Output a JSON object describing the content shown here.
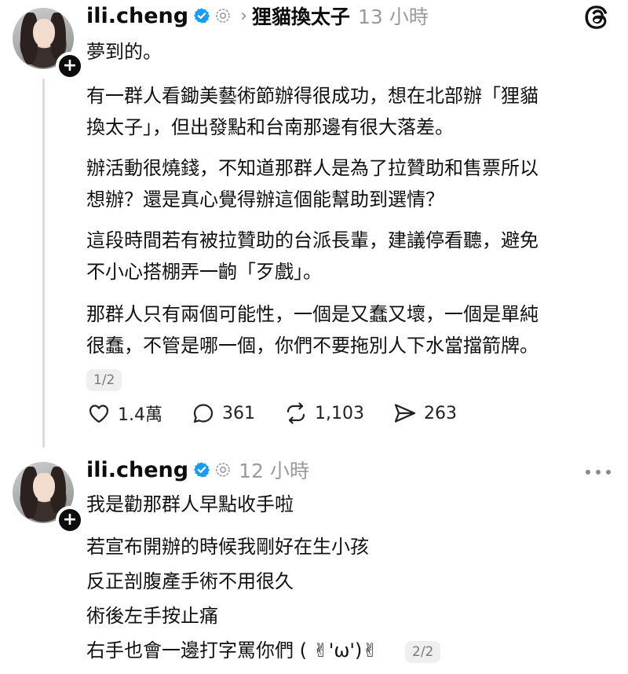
{
  "post1": {
    "username": "ili.cheng",
    "topic": "狸貓換太子",
    "time": "13 小時",
    "paragraphs": [
      [
        "夢到的。"
      ],
      [
        "有一群人看鋤美藝術節辦得很成功，想在北部辦「狸貓",
        "換太子」，但出發點和台南那邊有很大落差。"
      ],
      [
        "辦活動很燒錢，不知道那群人是為了拉贊助和售票所以",
        "想辦？還是真心覺得辦這個能幫助到選情？"
      ],
      [
        "這段時間若有被拉贊助的台派長輩，建議停看聽，避免",
        "不小心搭棚弄一齣「歹戲」。"
      ],
      [
        "那群人只有兩個可能性，一個是又蠢又壞，一個是單純",
        "很蠢，不管是哪一個，你們不要拖別人下水當擋箭牌。"
      ]
    ],
    "pager": "1/2",
    "likes": "1.4萬",
    "comments": "361",
    "reposts": "1,103",
    "shares": "263"
  },
  "post2": {
    "username": "ili.cheng",
    "time": "12 小時",
    "lines": [
      "我是勸那群人早點收手啦",
      "若宣布開辦的時候我剛好在生小孩",
      "反正剖腹產手術不用很久",
      "術後左手按止痛",
      "右手也會一邊打字罵你們 ( ✌︎'ω')✌︎"
    ],
    "pager": "2/2"
  },
  "icons": {
    "verified": "verified-badge-icon",
    "ring": "threads-ring-icon",
    "chevron": "chevron-right-icon",
    "like": "heart-icon",
    "comment": "comment-bubble-icon",
    "repost": "repost-icon",
    "share": "share-send-icon",
    "logo": "threads-logo-icon",
    "more": "more-options-icon"
  },
  "colors": {
    "verified_blue": "#1d9bf0",
    "text": "#101010",
    "muted": "#9a9a9a",
    "line": "#dcdcdc"
  }
}
